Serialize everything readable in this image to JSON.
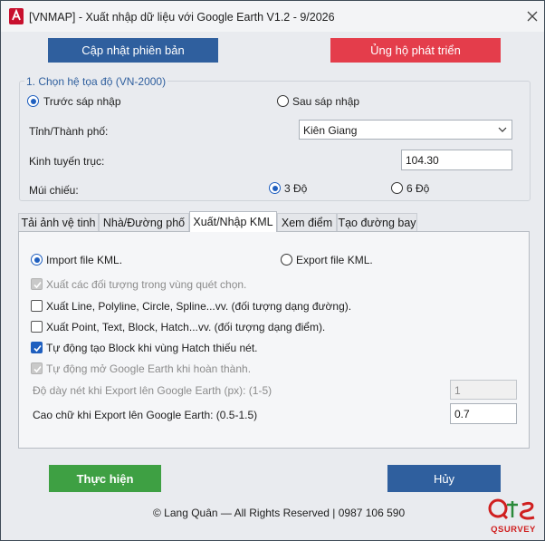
{
  "window": {
    "title": "[VNMAP] - Xuất nhập dữ liệu với Google Earth V1.2 - 9/2026"
  },
  "top_buttons": {
    "update": "Cập nhật phiên bản",
    "support": "Ủng hộ phát triển"
  },
  "coord_group": {
    "title": "1. Chọn hệ tọa độ (VN-2000)",
    "before_merge": "Trước sáp nhập",
    "after_merge": "Sau sáp nhập",
    "province_label": "Tỉnh/Thành phố:",
    "province_value": "Kiên Giang",
    "meridian_label": "Kinh tuyến trục:",
    "meridian_value": "104.30",
    "zone_label": "Múi chiếu:",
    "zone_3": "3 Độ",
    "zone_6": "6 Độ"
  },
  "tabs": [
    {
      "label": "Tải ảnh vệ tinh"
    },
    {
      "label": "Nhà/Đường phố"
    },
    {
      "label": "Xuất/Nhập KML"
    },
    {
      "label": "Xem điểm"
    },
    {
      "label": "Tạo đường bay"
    }
  ],
  "kml_panel": {
    "import_label": "Import file KML.",
    "export_label": "Export file KML.",
    "options": [
      {
        "label": "Xuất các đối tượng trong vùng quét chọn.",
        "checked": true,
        "disabled": true
      },
      {
        "label": "Xuất Line, Polyline, Circle, Spline...vv. (đối tượng dạng đường).",
        "checked": false,
        "disabled": false
      },
      {
        "label": "Xuất Point, Text, Block, Hatch...vv. (đối tượng dạng điểm).",
        "checked": false,
        "disabled": false
      },
      {
        "label": "Tự động tạo Block khi vùng Hatch thiếu nét.",
        "checked": true,
        "disabled": false
      },
      {
        "label": "Tự động mở Google Earth khi hoàn thành.",
        "checked": true,
        "disabled": true
      }
    ],
    "line_width_label": "Độ dày nét khi Export lên Google Earth (px): (1-5)",
    "line_width_value": "1",
    "text_height_label": "Cao chữ khi Export lên Google Earth: (0.5-1.5)",
    "text_height_value": "0.7"
  },
  "bottom_buttons": {
    "run": "Thực hiện",
    "cancel": "Hủy"
  },
  "footer": {
    "copyright": "© Lang Quân — All Rights Reserved | 0987 106 590",
    "logo_text": "QSURVEY"
  },
  "colors": {
    "accent_blue": "#2f5f9e",
    "support_red": "#e43d4b",
    "run_green": "#3ea043"
  }
}
